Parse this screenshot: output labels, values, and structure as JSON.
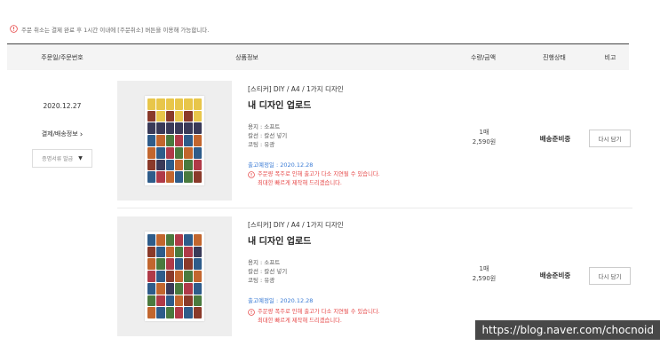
{
  "notice": {
    "text": "주문 취소는 결제 완료 후 1시간 이내에 [주문취소] 버튼을 이용해 가능합니다."
  },
  "table": {
    "headers": {
      "order": "주문일/주문번호",
      "product": "상품정보",
      "qty_price": "수량/금액",
      "status": "진행상태",
      "note": "비고"
    }
  },
  "order": {
    "date": "2020.12.27",
    "detail_link": "결제/배송정보",
    "certificate_select": "증명서류 발급"
  },
  "items": [
    {
      "category": "[스티커] DIY / A4 / 1가지 디자인",
      "name": "내 디자인 업로드",
      "options": [
        "용지 : 소프트",
        "칼선 : 칼선 넣기",
        "코팅 : 유광"
      ],
      "ship_date": "출고예정일 : 2020.12.28",
      "delay_line1": "주문량 폭주로 인해 출고가 다소 지연될 수 있습니다.",
      "delay_line2": "최대한 빠르게 제작해 드리겠습니다.",
      "qty": "1매",
      "price": "2,590원",
      "status": "배송준비중",
      "reorder_label": "다시 담기"
    },
    {
      "category": "[스티커] DIY / A4 / 1가지 디자인",
      "name": "내 디자인 업로드",
      "options": [
        "용지 : 소프트",
        "칼선 : 칼선 넣기",
        "코팅 : 유광"
      ],
      "ship_date": "출고예정일 : 2020.12.28",
      "delay_line1": "주문량 폭주로 인해 출고가 다소 지연될 수 있습니다.",
      "delay_line2": "최대한 빠르게 제작해 드리겠습니다.",
      "qty": "1매",
      "price": "2,590원",
      "status": "배송준비중",
      "reorder_label": "다시 담기"
    }
  ],
  "watermark": "https://blog.naver.com/chocnoid",
  "colors": {
    "warning": "#e64545",
    "ship_date": "#3a7bd5",
    "header_bg": "#f4f4f4"
  },
  "icons": {
    "notice": "warning-circle-icon",
    "dropdown": "caret-down-icon",
    "detail": "chevron-right-icon"
  }
}
